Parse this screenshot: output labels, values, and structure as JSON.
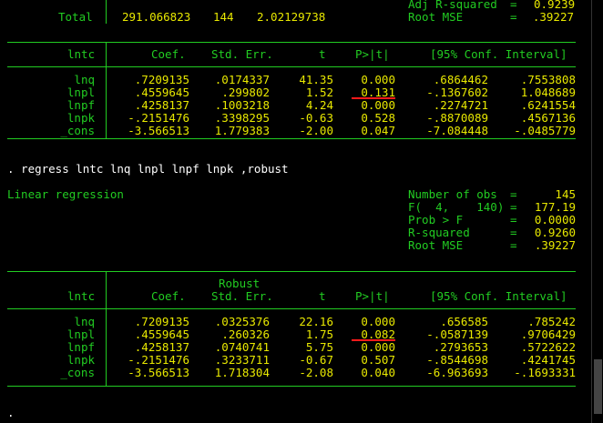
{
  "summary": {
    "total_label": "Total",
    "total_ss": "291.066823",
    "total_df": "144",
    "total_ms": "2.02129738",
    "adj_r2_label": "Adj R-squared",
    "adj_r2_eq": "=",
    "adj_r2_value": "0.9239",
    "root_mse_label": "Root MSE",
    "root_mse_eq": "=",
    "root_mse_value": ".39227"
  },
  "table1": {
    "headers": {
      "dep": "lntc",
      "coef": "Coef.",
      "se": "Std. Err.",
      "t": "t",
      "p": "P>|t|",
      "ci": "[95% Conf. Interval]"
    },
    "rows": [
      {
        "var": "lnq",
        "coef": ".7209135",
        "se": ".0174337",
        "t": "41.35",
        "p": "0.000",
        "lo": ".6864462",
        "hi": ".7553808"
      },
      {
        "var": "lnpl",
        "coef": ".4559645",
        "se": ".299802",
        "t": "1.52",
        "p": "0.131",
        "lo": "-.1367602",
        "hi": "1.048689"
      },
      {
        "var": "lnpf",
        "coef": ".4258137",
        "se": ".1003218",
        "t": "4.24",
        "p": "0.000",
        "lo": ".2274721",
        "hi": ".6241554"
      },
      {
        "var": "lnpk",
        "coef": "-.2151476",
        "se": ".3398295",
        "t": "-0.63",
        "p": "0.528",
        "lo": "-.8870089",
        "hi": ".4567136"
      },
      {
        "var": "_cons",
        "coef": "-3.566513",
        "se": "1.779383",
        "t": "-2.00",
        "p": "0.047",
        "lo": "-7.084448",
        "hi": "-.0485779"
      }
    ]
  },
  "command": ". regress lntc lnq lnpl lnpf lnpk ,robust",
  "model": {
    "title": "Linear regression",
    "stats": [
      {
        "label": "Number of obs",
        "eq": "=",
        "value": "145"
      },
      {
        "label": "F(  4,    140)",
        "eq": "=",
        "value": "177.19"
      },
      {
        "label": "Prob > F",
        "eq": "=",
        "value": "0.0000"
      },
      {
        "label": "R-squared",
        "eq": "=",
        "value": "0.9260"
      },
      {
        "label": "Root MSE",
        "eq": "=",
        "value": ".39227"
      }
    ]
  },
  "table2": {
    "robust_label": "Robust",
    "headers": {
      "dep": "lntc",
      "coef": "Coef.",
      "se": "Std. Err.",
      "t": "t",
      "p": "P>|t|",
      "ci": "[95% Conf. Interval]"
    },
    "rows": [
      {
        "var": "lnq",
        "coef": ".7209135",
        "se": ".0325376",
        "t": "22.16",
        "p": "0.000",
        "lo": ".656585",
        "hi": ".785242"
      },
      {
        "var": "lnpl",
        "coef": ".4559645",
        "se": ".260326",
        "t": "1.75",
        "p": "0.082",
        "lo": "-.0587139",
        "hi": ".9706429"
      },
      {
        "var": "lnpf",
        "coef": ".4258137",
        "se": ".0740741",
        "t": "5.75",
        "p": "0.000",
        "lo": ".2793653",
        "hi": ".5722622"
      },
      {
        "var": "lnpk",
        "coef": "-.2151476",
        "se": ".3233711",
        "t": "-0.67",
        "p": "0.507",
        "lo": "-.8544698",
        "hi": ".4241745"
      },
      {
        "var": "_cons",
        "coef": "-3.566513",
        "se": "1.718304",
        "t": "-2.08",
        "p": "0.040",
        "lo": "-6.963693",
        "hi": "-.1693331"
      }
    ]
  },
  "prompt": ".",
  "colors": {
    "green": "#22cc22",
    "yellow": "#e8e800",
    "white": "#ffffff",
    "annotation": "#ff1a1a"
  }
}
